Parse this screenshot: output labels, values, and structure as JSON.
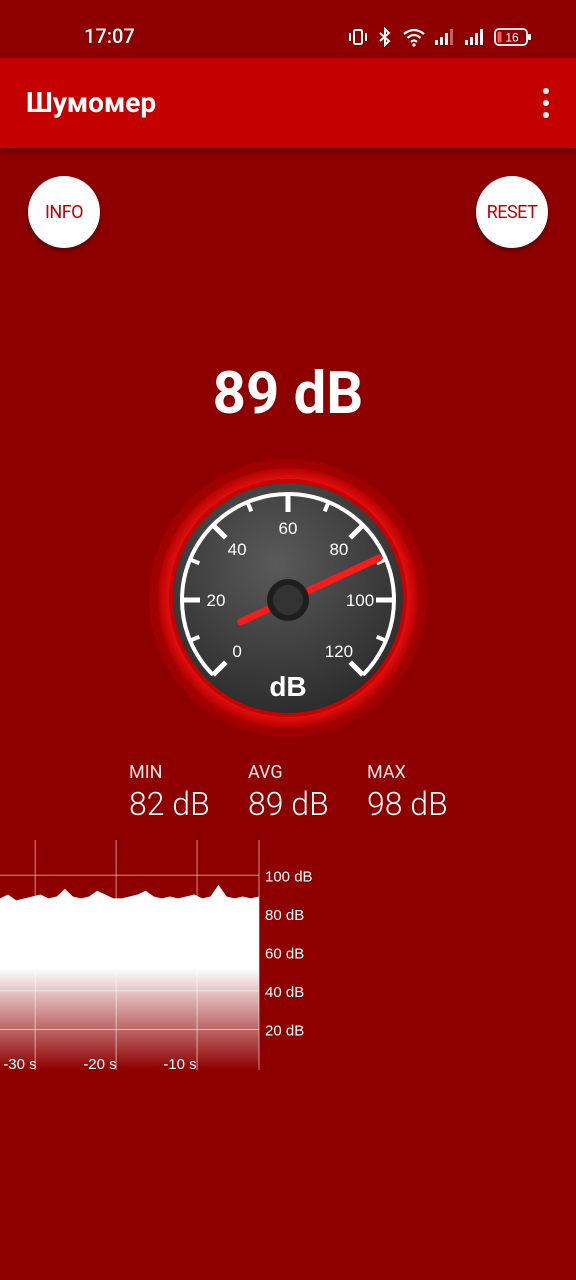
{
  "status_bar": {
    "time": "17:07",
    "battery": "16",
    "icons": [
      "vibrate-icon",
      "bluetooth-icon",
      "wifi-icon",
      "signal-icon",
      "signal-icon",
      "battery-icon"
    ]
  },
  "app_bar": {
    "title": "Шумомер",
    "menu_icon": "more-vert-icon"
  },
  "buttons": {
    "info": "INFO",
    "reset": "RESET"
  },
  "reading": {
    "value_text": "89 dB",
    "value": 89
  },
  "gauge": {
    "unit": "dB",
    "ticks": [
      "0",
      "20",
      "40",
      "60",
      "80",
      "100",
      "120"
    ],
    "min": 0,
    "max": 120,
    "needle_value": 89
  },
  "stats": {
    "min": {
      "label": "MIN",
      "value": "82 dB"
    },
    "avg": {
      "label": "AVG",
      "value": "89 dB"
    },
    "max": {
      "label": "MAX",
      "value": "98 dB"
    }
  },
  "colors": {
    "background": "#8e0000",
    "app_bar": "#c40000",
    "accent": "#ff1a1a"
  },
  "chart_data": {
    "type": "area",
    "title": "",
    "xlabel": "",
    "ylabel": "",
    "x_ticks": [
      "-30 s",
      "-20 s",
      "-10 s"
    ],
    "y_ticks": [
      "20 dB",
      "40 dB",
      "60 dB",
      "80 dB",
      "100 dB"
    ],
    "xlim": [
      -32,
      0
    ],
    "ylim": [
      0,
      110
    ],
    "x": [
      -32,
      -31,
      -30,
      -29,
      -28,
      -27,
      -26,
      -25,
      -24,
      -23,
      -22,
      -21,
      -20,
      -19,
      -18,
      -17,
      -16,
      -15,
      -14,
      -13,
      -12,
      -11,
      -10,
      -9,
      -8,
      -7,
      -6,
      -5,
      -4,
      -3,
      -2,
      -1,
      0
    ],
    "y": [
      88,
      90,
      87,
      88,
      89,
      90,
      88,
      89,
      93,
      89,
      88,
      89,
      92,
      90,
      88,
      88,
      89,
      90,
      92,
      89,
      88,
      89,
      88,
      89,
      90,
      88,
      89,
      95,
      89,
      88,
      89,
      88,
      89
    ]
  }
}
